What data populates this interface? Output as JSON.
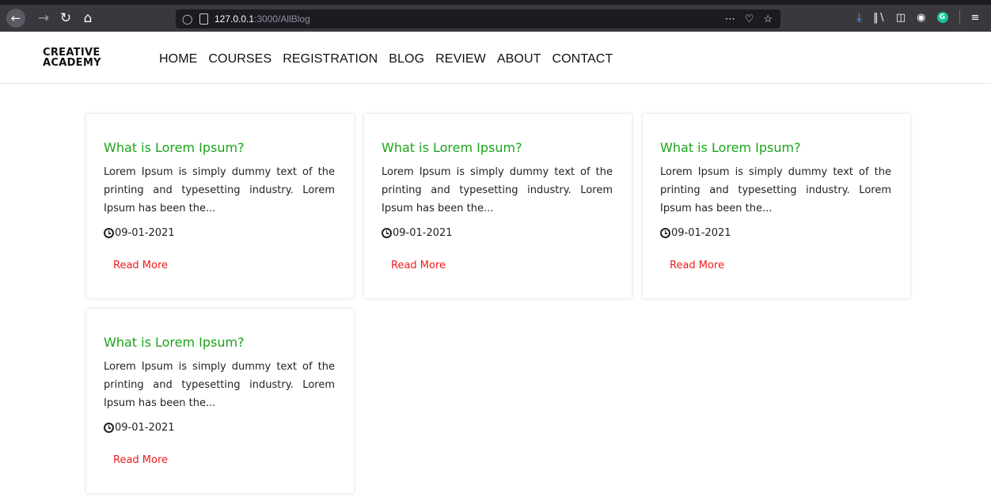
{
  "browser": {
    "url_host": "127.0.0.1",
    "url_path": ":3000/AllBlog",
    "icons": [
      "back-icon",
      "forward-icon",
      "reload-icon",
      "home-icon",
      "shield-icon",
      "page-icon",
      "more-icon",
      "pocket-icon",
      "star-icon",
      "download-icon",
      "library-icon",
      "sidebar-icon",
      "account-icon",
      "grammarly-icon",
      "menu-icon"
    ],
    "accent": "#45a1ff"
  },
  "site": {
    "logo_line1": "CREATIVE",
    "logo_line2": "ACADEMY",
    "nav": [
      "HOME",
      "COURSES",
      "REGISTRATION",
      "BLOG",
      "REVIEW",
      "ABOUT",
      "CONTACT"
    ]
  },
  "colors": {
    "title": "#1aa51a",
    "read_more": "#ee1c1c"
  },
  "posts": [
    {
      "title": "What is Lorem Ipsum?",
      "excerpt": "Lorem Ipsum is simply dummy text of the printing and typesetting industry. Lorem Ipsum has been the...",
      "date": "09-01-2021",
      "link": "Read More"
    },
    {
      "title": "What is Lorem Ipsum?",
      "excerpt": "Lorem Ipsum is simply dummy text of the printing and typesetting industry. Lorem Ipsum has been the...",
      "date": "09-01-2021",
      "link": "Read More"
    },
    {
      "title": "What is Lorem Ipsum?",
      "excerpt": "Lorem Ipsum is simply dummy text of the printing and typesetting industry. Lorem Ipsum has been the...",
      "date": "09-01-2021",
      "link": "Read More"
    },
    {
      "title": "What is Lorem Ipsum?",
      "excerpt": "Lorem Ipsum is simply dummy text of the printing and typesetting industry. Lorem Ipsum has been the...",
      "date": "09-01-2021",
      "link": "Read More"
    }
  ]
}
